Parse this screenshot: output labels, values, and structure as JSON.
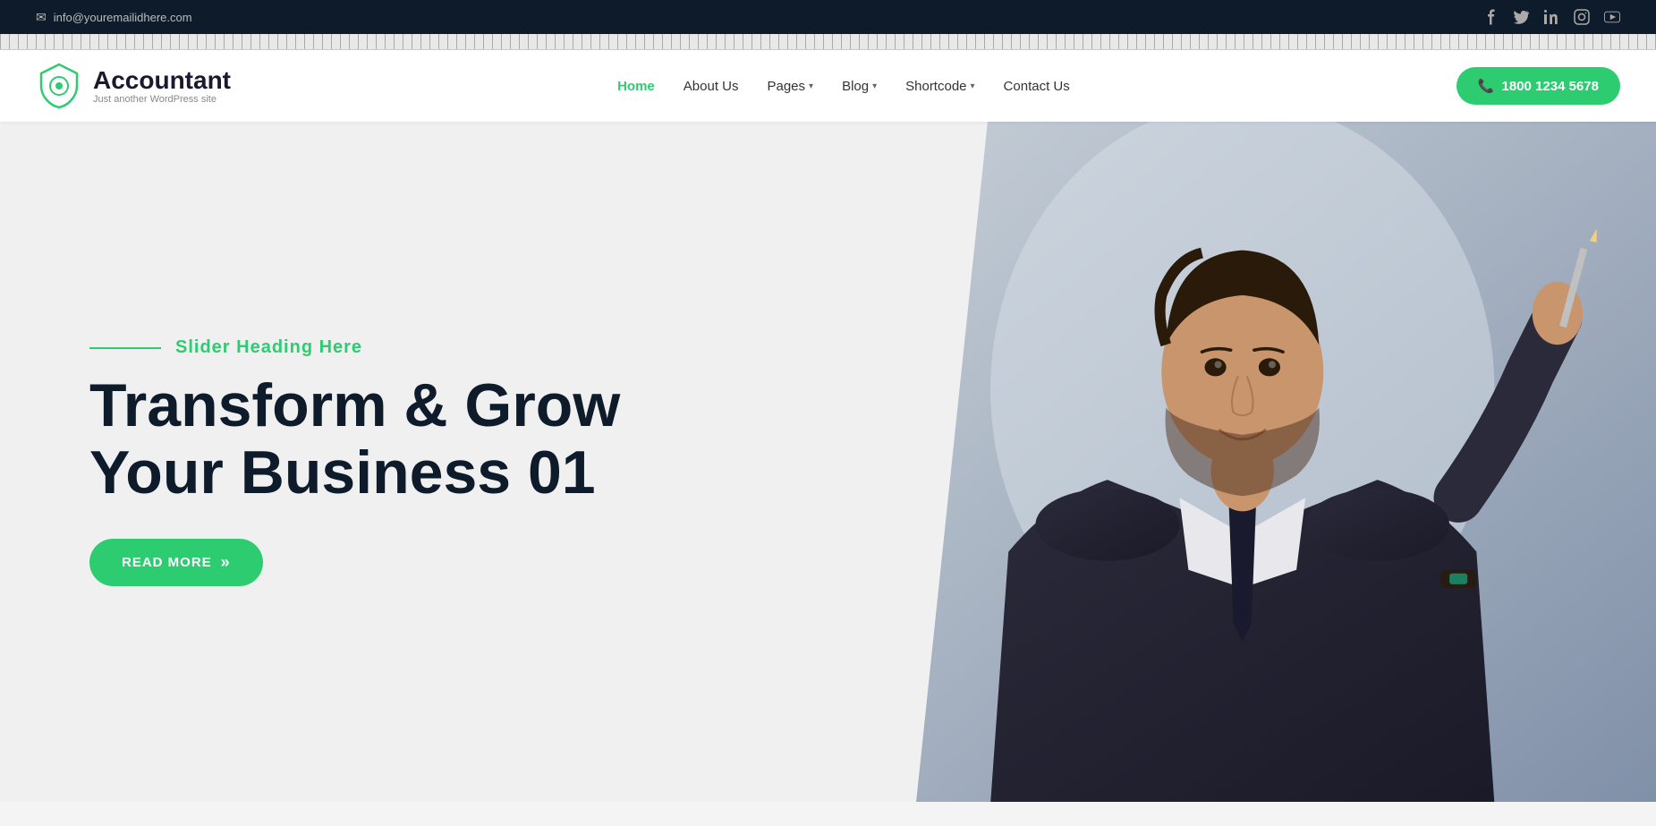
{
  "topbar": {
    "email": "info@youremailidhere.com",
    "email_icon": "envelope-icon"
  },
  "social": [
    {
      "name": "facebook-icon",
      "symbol": "f"
    },
    {
      "name": "twitter-icon",
      "symbol": "t"
    },
    {
      "name": "linkedin-icon",
      "symbol": "in"
    },
    {
      "name": "instagram-icon",
      "symbol": "ig"
    },
    {
      "name": "youtube-icon",
      "symbol": "yt"
    }
  ],
  "header": {
    "logo": {
      "title": "Accountant",
      "subtitle": "Just another WordPress site"
    },
    "nav": [
      {
        "label": "Home",
        "active": true,
        "has_dropdown": false
      },
      {
        "label": "About Us",
        "active": false,
        "has_dropdown": false
      },
      {
        "label": "Pages",
        "active": false,
        "has_dropdown": true
      },
      {
        "label": "Blog",
        "active": false,
        "has_dropdown": true
      },
      {
        "label": "Shortcode",
        "active": false,
        "has_dropdown": true
      },
      {
        "label": "Contact Us",
        "active": false,
        "has_dropdown": false
      }
    ],
    "phone_button": "1800 1234 5678"
  },
  "hero": {
    "slider_heading": "Slider Heading Here",
    "main_title_line1": "Transform & Grow",
    "main_title_line2": "Your Business 01",
    "read_more_label": "READ MORE",
    "colors": {
      "accent": "#2ecc71",
      "dark": "#0d1b2a"
    }
  }
}
